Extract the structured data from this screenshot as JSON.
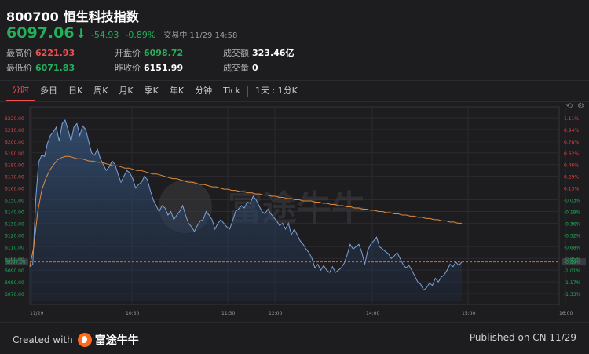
{
  "header": {
    "code": "800700",
    "name": "恒生科技指数",
    "price": "6097.06",
    "arrow": "↓",
    "change": "-54.93",
    "change_pct": "-0.89%",
    "status": "交易中 11/29 14:58",
    "price_color": "#22b05a"
  },
  "stats": {
    "high_label": "最高价",
    "high": "6221.93",
    "low_label": "最低价",
    "low": "6071.83",
    "open_label": "开盘价",
    "open": "6098.72",
    "prev_close_label": "昨收价",
    "prev_close": "6151.99",
    "turnover_label": "成交额",
    "turnover": "323.46亿",
    "volume_label": "成交量",
    "volume": "0"
  },
  "tabs": [
    "分时",
    "多日",
    "日K",
    "周K",
    "月K",
    "季K",
    "年K",
    "分钟",
    "Tick"
  ],
  "active_tab": "分时",
  "period_selector": "1天 : 1分K",
  "watermark": "富途牛牛",
  "footer": {
    "created_with": "Created with",
    "brand": "富途牛牛",
    "published": "Published on CN 11/29"
  },
  "icons": [
    "refresh-icon",
    "settings-icon"
  ],
  "chart_data": {
    "type": "area",
    "y_ticks_left": [
      "6220.00",
      "6210.00",
      "6200.00",
      "6190.00",
      "6180.00",
      "6170.00",
      "6160.00",
      "6150.00",
      "6140.00",
      "6130.00",
      "6120.00",
      "6110.00",
      "6100.00",
      "6090.00",
      "6080.00",
      "6070.00"
    ],
    "y_ticks_right": [
      "1.11%",
      "0.94%",
      "0.78%",
      "0.62%",
      "0.46%",
      "0.29%",
      "0.13%",
      "-0.03%",
      "-0.19%",
      "-0.36%",
      "-0.52%",
      "-0.68%",
      "-0.85%",
      "-1.01%",
      "-1.17%",
      "-1.33%"
    ],
    "x_ticks": [
      "11/29",
      "10:30",
      "11:30",
      "12:00",
      "14:00",
      "15:00",
      "16:00"
    ],
    "ylim": [
      6064,
      6226
    ],
    "current_price": 6097.06,
    "current_pct_label": "-0.89%",
    "series": [
      {
        "values": [
          6093,
          6095,
          6150,
          6182,
          6188,
          6187,
          6198,
          6205,
          6208,
          6212,
          6200,
          6215,
          6218,
          6210,
          6200,
          6212,
          6215,
          6205,
          6213,
          6210,
          6200,
          6190,
          6188,
          6193,
          6185,
          6180,
          6175,
          6178,
          6183,
          6180,
          6172,
          6165,
          6170,
          6175,
          6173,
          6168,
          6160,
          6163,
          6165,
          6170,
          6167,
          6158,
          6150,
          6145,
          6140,
          6145,
          6143,
          6137,
          6140,
          6133,
          6137,
          6140,
          6145,
          6137,
          6130,
          6127,
          6123,
          6128,
          6132,
          6133,
          6140,
          6137,
          6133,
          6125,
          6130,
          6133,
          6130,
          6127,
          6125,
          6132,
          6140,
          6142,
          6145,
          6143,
          6148,
          6147,
          6153,
          6150,
          6145,
          6140,
          6138,
          6142,
          6138,
          6135,
          6132,
          6128,
          6130,
          6125,
          6130,
          6120,
          6125,
          6120,
          6115,
          6112,
          6108,
          6105,
          6100,
          6092,
          6095,
          6090,
          6094,
          6090,
          6088,
          6093,
          6088,
          6090,
          6092,
          6096,
          6103,
          6112,
          6108,
          6110,
          6112,
          6105,
          6095,
          6107,
          6112,
          6115,
          6118,
          6110,
          6108,
          6106,
          6104,
          6100,
          6102,
          6105,
          6100,
          6095,
          6092,
          6094,
          6090,
          6085,
          6080,
          6078,
          6073,
          6075,
          6079,
          6077,
          6083,
          6080,
          6084,
          6086,
          6090,
          6095,
          6093,
          6097,
          6094,
          6097
        ]
      },
      {
        "values": [
          6093,
          6110,
          6140,
          6158,
          6168,
          6175,
          6180,
          6184,
          6186,
          6187,
          6187,
          6186,
          6185,
          6185,
          6184,
          6183,
          6183,
          6182,
          6182,
          6181,
          6180,
          6179,
          6179,
          6178,
          6177,
          6177,
          6176,
          6175,
          6175,
          6174,
          6173,
          6172,
          6172,
          6171,
          6170,
          6169,
          6168,
          6168,
          6167,
          6166,
          6165,
          6165,
          6164,
          6163,
          6163,
          6162,
          6161,
          6161,
          6160,
          6159,
          6159,
          6158,
          6158,
          6157,
          6157,
          6156,
          6156,
          6155,
          6155,
          6154,
          6154,
          6153,
          6153,
          6152,
          6152,
          6151,
          6151,
          6150,
          6150,
          6149,
          6149,
          6149,
          6148,
          6148,
          6147,
          6147,
          6146,
          6146,
          6145,
          6145,
          6144,
          6144,
          6143,
          6143,
          6142,
          6142,
          6141,
          6141,
          6140,
          6140,
          6139,
          6139,
          6138,
          6138,
          6137,
          6137,
          6136,
          6136,
          6135,
          6135,
          6134,
          6134,
          6133,
          6133,
          6132,
          6132,
          6131,
          6131,
          6130,
          6130
        ]
      }
    ]
  }
}
